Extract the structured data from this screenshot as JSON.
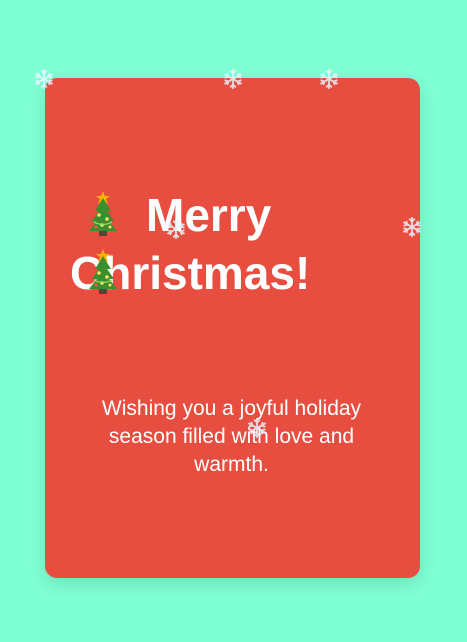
{
  "card": {
    "title": "Merry Christmas!",
    "message": "Wishing you a joyful holiday season filled with love and warmth."
  },
  "icons": {
    "tree": "christmas-tree-icon",
    "snowflake": "snowflake-icon"
  },
  "colors": {
    "background": "#7fffd4",
    "card": "#e84e3f",
    "text": "#ffffff",
    "tree_green": "#2e7d32",
    "star": "#f5b400",
    "snowflake": "#e8f4ff"
  }
}
